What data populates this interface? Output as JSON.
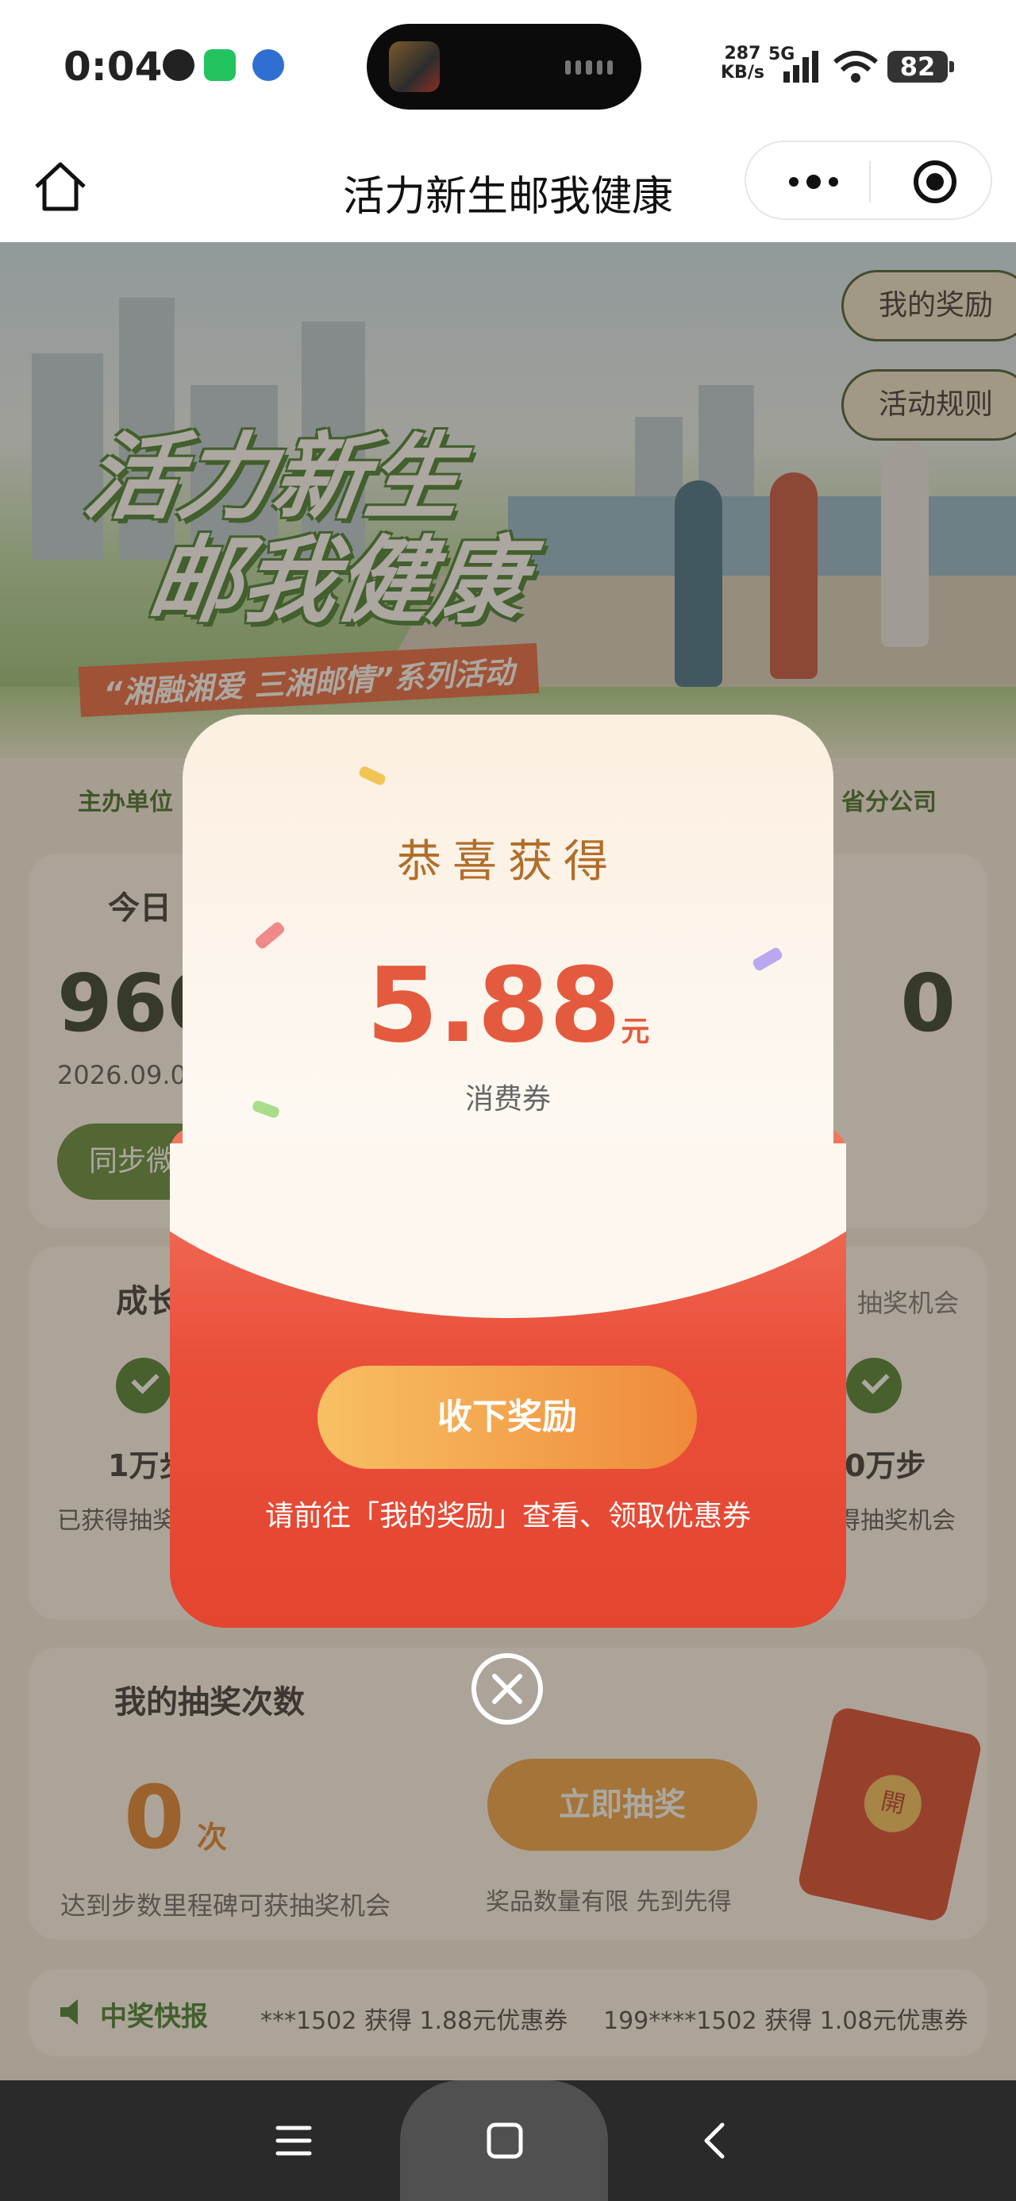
{
  "status_bar": {
    "time": "0:04",
    "net_speed_value": "287",
    "net_speed_unit": "KB/s",
    "network": "5G",
    "battery": "82",
    "app_icons": [
      "qq-icon",
      "wechat-icon",
      "app-icon"
    ]
  },
  "nav": {
    "title": "活力新生邮我健康"
  },
  "hero": {
    "title_line1": "活力新生",
    "title_line2": "邮我健康",
    "subtitle": "“湘融湘爱 三湘邮情”系列活动",
    "my_rewards_button": "我的奖励",
    "rules_button": "活动规则",
    "organizer_left": "主办单位",
    "organizer_right": "省分公司"
  },
  "steps_card": {
    "title": "今日",
    "steps": "960",
    "steps_right": "0",
    "date": "2026.09.0",
    "sync_button": "同步微"
  },
  "growth_card": {
    "title": "成长",
    "right_label": "抽奖机会",
    "milestones": [
      {
        "label": "1万步",
        "sub": "已获得抽奖"
      },
      {
        "label": "0万步",
        "sub": "得抽奖机会"
      }
    ]
  },
  "draw_card": {
    "title": "我的抽奖次数",
    "count": "0",
    "unit": "次",
    "hint": "达到步数里程碑可获抽奖机会",
    "draw_button": "立即抽奖",
    "limit_note": "奖品数量有限 先到先得",
    "envelope_seal": "開"
  },
  "news": {
    "label": "中奖快报",
    "items": [
      "***1502 获得 1.88元优惠券",
      "199****1502 获得 1.08元优惠券"
    ]
  },
  "modal": {
    "congrats": "恭喜获得",
    "amount": "5.88",
    "amount_unit": "元",
    "coupon_type": "消费券",
    "accept_button": "收下奖励",
    "tip": "请前往「我的奖励」查看、领取优惠券"
  },
  "colors": {
    "brand_green": "#4a7e30",
    "envelope_red": "#e8503c",
    "amount_red": "#e45a3e",
    "gold": "#b26d2a",
    "button_orange": "#ef8a3a"
  }
}
